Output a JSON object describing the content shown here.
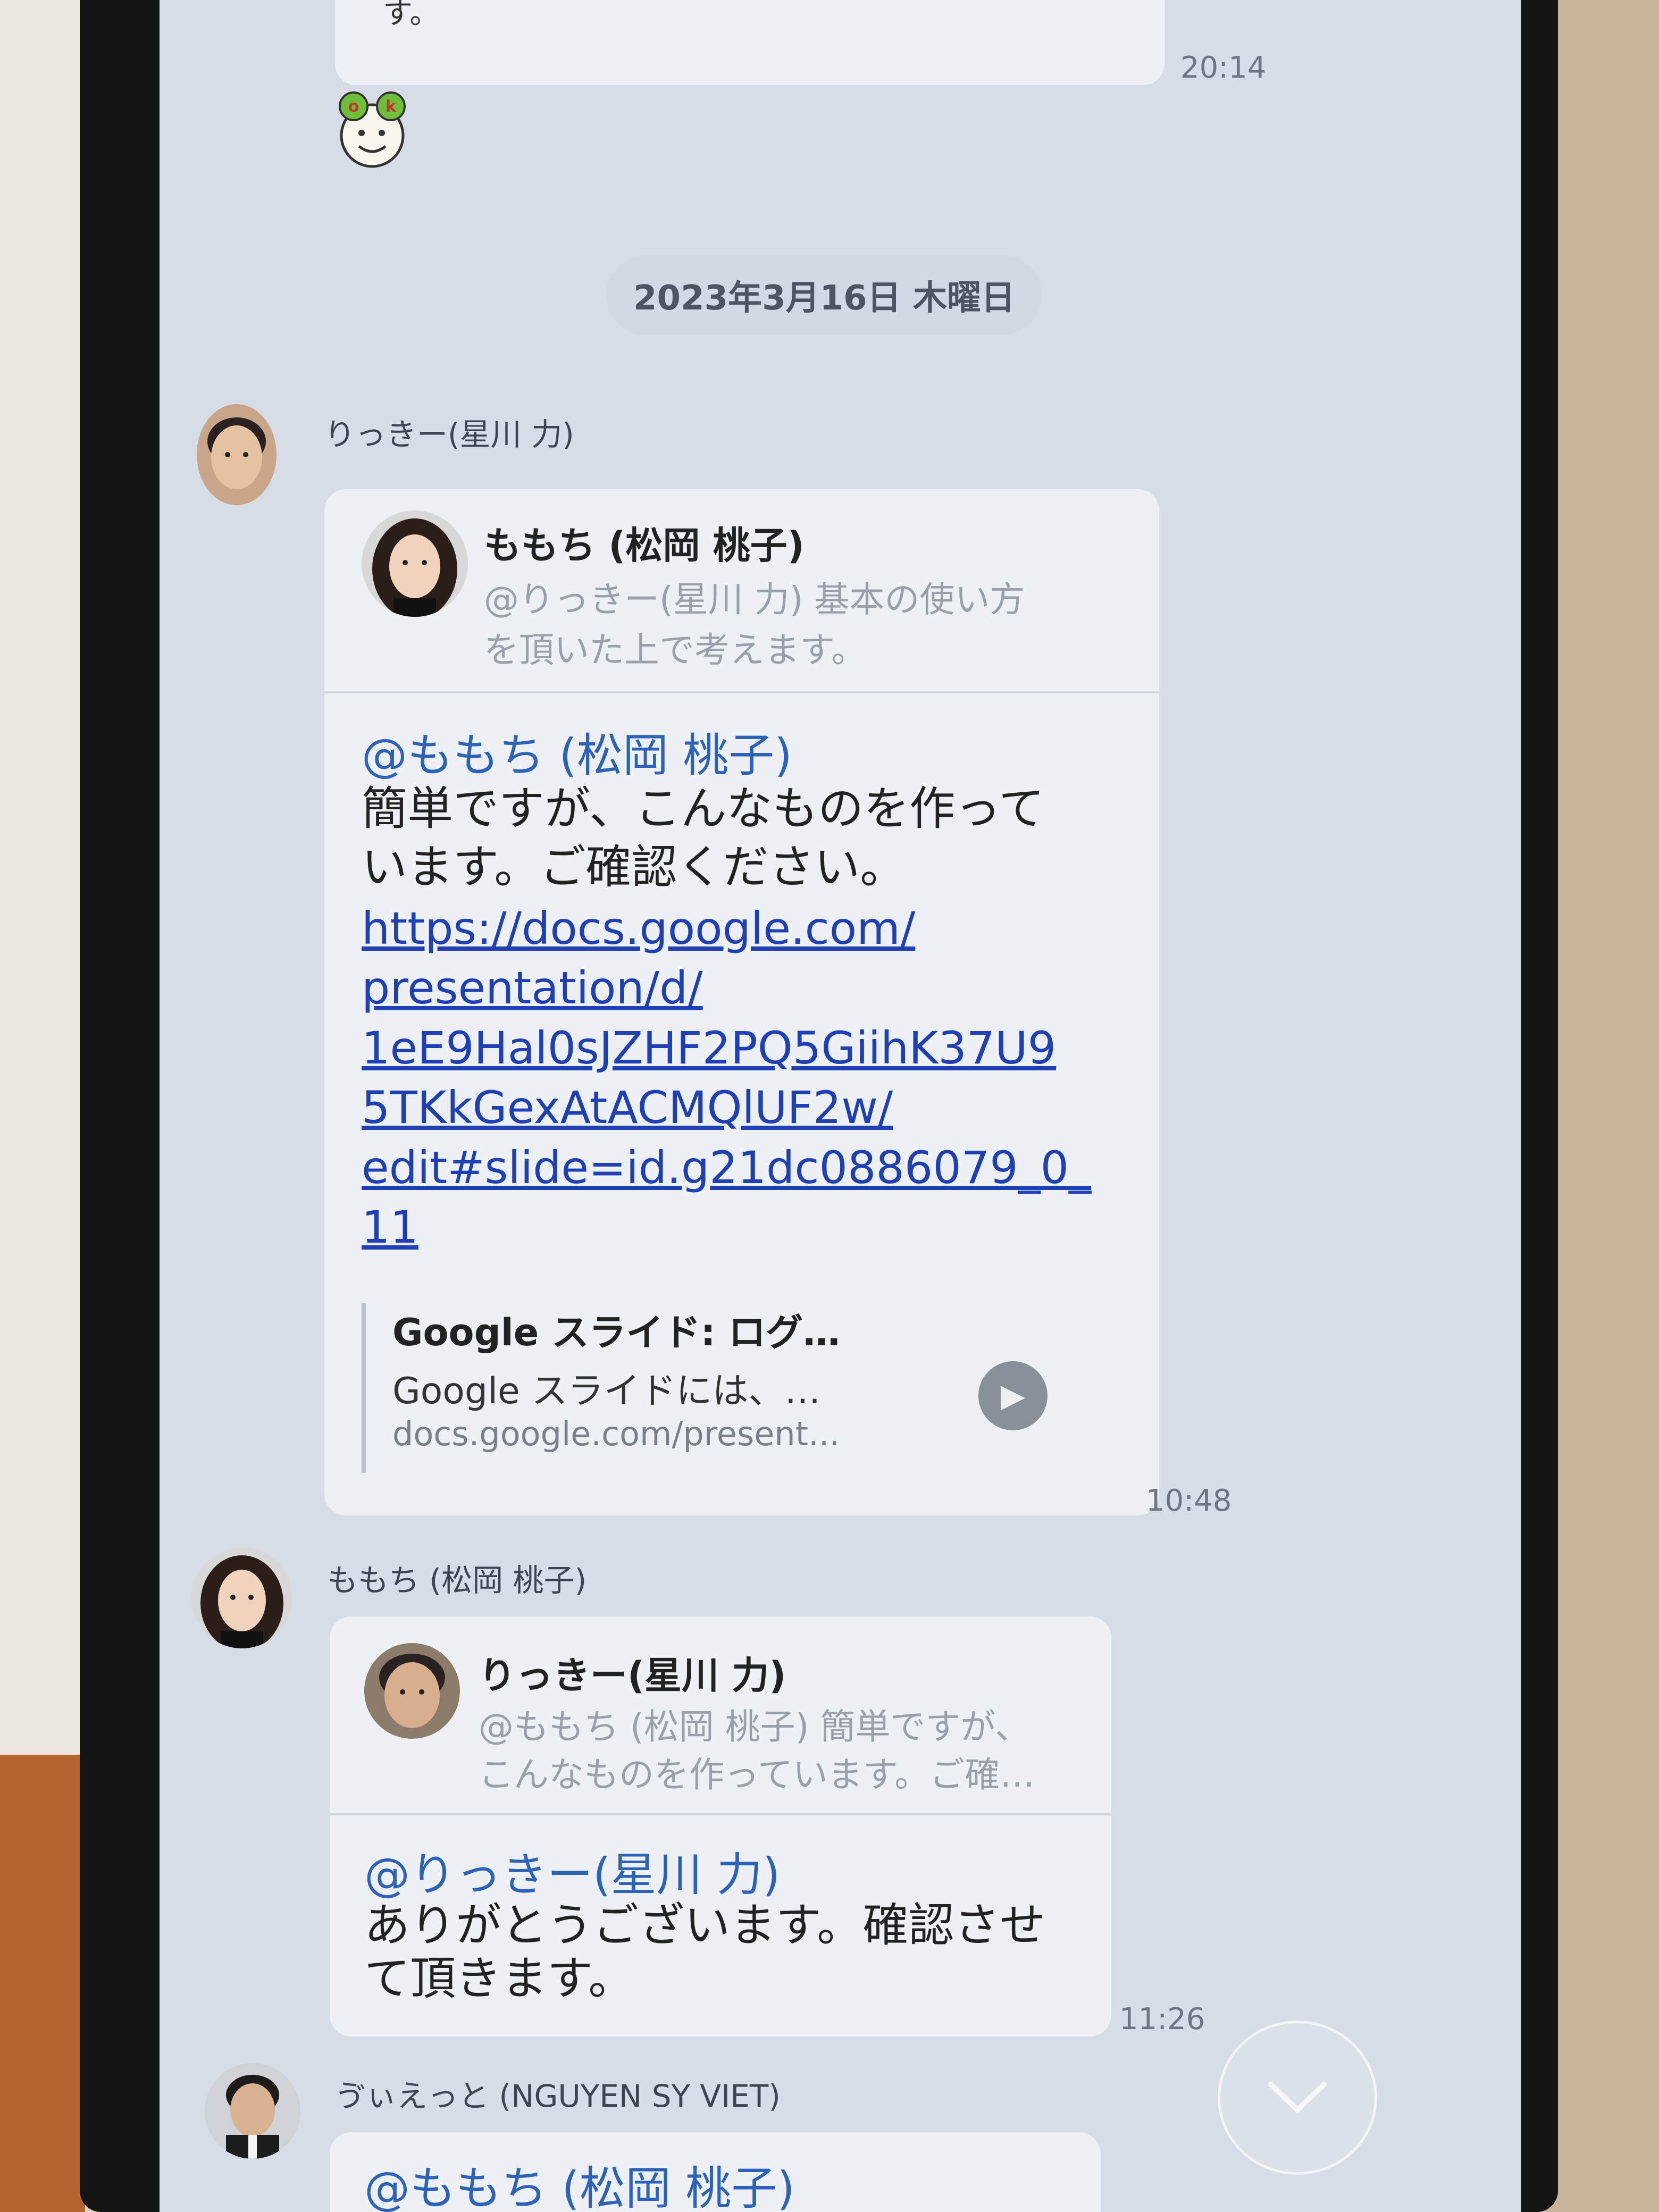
{
  "chat": {
    "prev_message_tail": "す。",
    "prev_time": "20:14",
    "sticker": "ok-sticker",
    "date_separator": "2023年3月16日 木曜日",
    "messages": [
      {
        "sender": "りっきー(星川 力)",
        "quote_name": "ももち (松岡 桃子)",
        "quote_line1": "@りっきー(星川 力) 基本の使い方",
        "quote_line2": "を頂いた上で考えます。",
        "mention": "@ももち (松岡 桃子)",
        "body_line1": "簡単ですが、こんなものを作って",
        "body_line2": "います。ご確認ください。",
        "link_lines": [
          "https://docs.google.com/",
          "presentation/d/",
          "1eE9Hal0sJZHF2PQ5GiihK37U9",
          "5TKkGexAtACMQlUF2w/",
          "edit#slide=id.g21dc0886079_0_",
          "11"
        ],
        "preview_title": "Google スライド: ログ…",
        "preview_desc": "Google スライドには、…",
        "preview_url": "docs.google.com/present...",
        "time": "10:48"
      },
      {
        "sender": "ももち (松岡 桃子)",
        "quote_name": "りっきー(星川 力)",
        "quote_line1": "@ももち (松岡 桃子) 簡単ですが、",
        "quote_line2": "こんなものを作っています。ご確…",
        "mention": "@りっきー(星川 力)",
        "body_line1": "ありがとうございます。確認させ",
        "body_line2": "て頂きます。",
        "time": "11:26"
      },
      {
        "sender": "ゔぃえっと (NGUYEN SY VIET)",
        "mention": "@ももち (松岡 桃子)"
      }
    ]
  },
  "icons": {
    "play": "play-icon",
    "scroll_down": "chevron-down-icon"
  }
}
